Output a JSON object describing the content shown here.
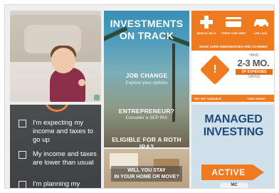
{
  "checklist": {
    "items": [
      "I'm expecting my income and taxes to go up",
      "My income and taxes are lower than usual",
      "I'm planning my"
    ]
  },
  "investments": {
    "title": "INVESTMENTS ON TRACK",
    "job_change": "JOB CHANGE",
    "job_change_sub": "Explore your options",
    "entrepreneur": "ENTREPRENEUR?",
    "entrepreneur_sub": "Consider a SEP IRA",
    "roth": "ELIGIBLE FOR A ROTH IRA?"
  },
  "home": {
    "line1": "WILL YOU STAY",
    "line2": "IN YOUR HOME OR MOVE?"
  },
  "emergency": {
    "icon_labels": [
      "MEDICAL BILLS",
      "CREDIT CARD DEBT",
      "CAR LOAN"
    ],
    "heading": "MAKE SURE EMERGENCIES ARE COVERED",
    "have": "HAVE",
    "months": "2-3 MO.",
    "of_expenses": "OF EXPENSES",
    "saved": "SAVED",
    "footer_left": "PAY OFF VARIABLE",
    "footer_right": "THEN INVEST"
  },
  "managed": {
    "title": "MANAGED INVESTING",
    "active": "ACTIVE",
    "partial": "MC"
  },
  "colors": {
    "orange": "#f07a1f",
    "navy": "#1c4a7a"
  }
}
